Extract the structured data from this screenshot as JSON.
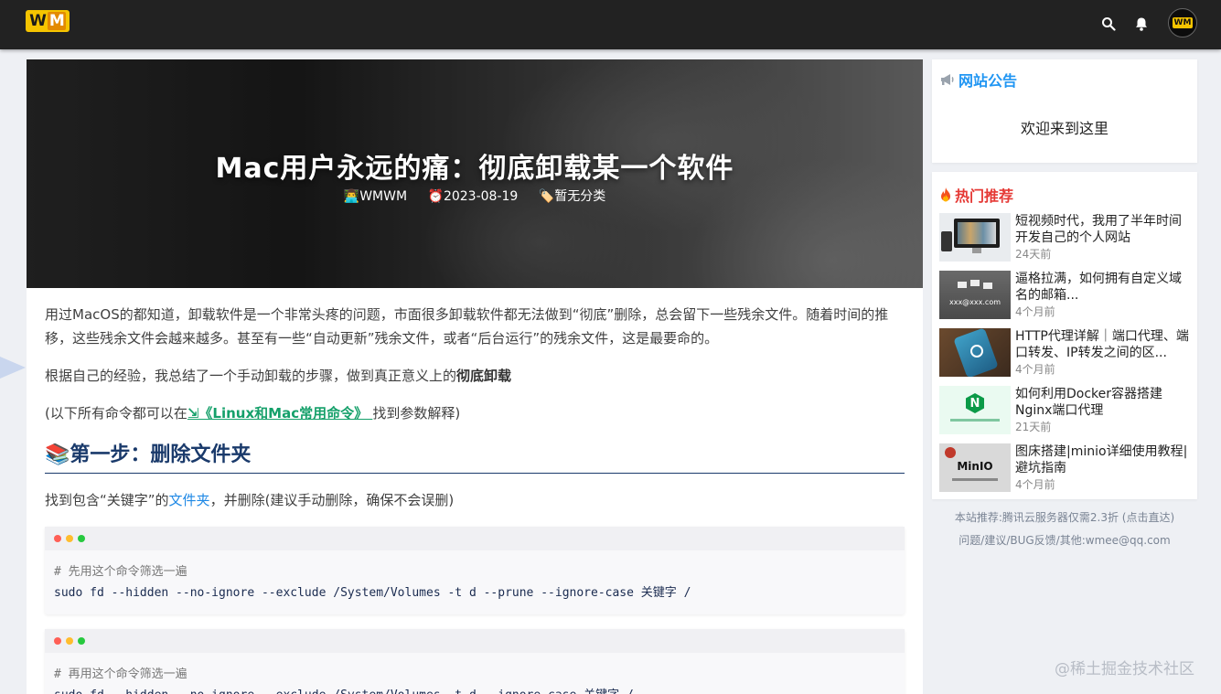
{
  "header": {
    "logo_w": "W",
    "logo_m": "M",
    "avatar_text": "WM",
    "icons": [
      "search-icon",
      "bell-icon"
    ]
  },
  "article": {
    "title": "Mac用户永远的痛：彻底卸载某一个软件",
    "author": "👨‍💻WMWM",
    "date": "⏰2023-08-19",
    "category": "🏷️暂无分类",
    "para1": "用过MacOS的都知道，卸载软件是一个非常头疼的问题，市面很多卸载软件都无法做到“彻底”删除，总会留下一些残余文件。随着时间的推移，这些残余文件会越来越多。甚至有一些“自动更新”残余文件，或者“后台运行”的残余文件，这是最要命的。",
    "para2_prefix": "根据自己的经验，我总结了一个手动卸载的步骤，做到真正意义上的",
    "para2_bold": "彻底卸载",
    "para3_prefix": "(以下所有命令都可以在",
    "para3_link": "⇲《Linux和Mac常用命令》 ",
    "para3_suffix": "找到参数解释)",
    "step1_heading": "📚第一步：删除文件夹",
    "step1_text_prefix": "找到包含“关键字”的",
    "step1_text_link": "文件夹",
    "step1_text_suffix": "，并删除(建议手动删除，确保不会误删)",
    "code1_comment": "# 先用这个命令筛选一遍",
    "code1_cmd": "sudo fd --hidden --no-ignore --exclude /System/Volumes  -t d --prune --ignore-case 关键字 /",
    "code2_comment": "# 再用这个命令筛选一遍",
    "code2_cmd": "sudo fd --hidden --no-ignore --exclude /System/Volumes  -t d --ignore-case 关键字 /"
  },
  "sidebar": {
    "notice_title": "网站公告",
    "notice_text": "欢迎来到这里",
    "hot_title": "热门推荐",
    "hot_items": [
      {
        "title": "短视频时代，我用了半年时间开发自己的个人网站",
        "date": "24天前"
      },
      {
        "title": "逼格拉满，如何拥有自定义域名的邮箱...",
        "date": "4个月前"
      },
      {
        "title": "HTTP代理详解｜端口代理、端口转发、IP转发之间的区...",
        "date": "4个月前"
      },
      {
        "title": "如何利用Docker容器搭建Nginx端口代理",
        "date": "21天前"
      },
      {
        "title": "图床搭建|minio详细使用教程|避坑指南",
        "date": "4个月前"
      }
    ],
    "thumb_texts": {
      "email": "xxx@xxx.com",
      "nginx": "N",
      "minio": "MinIO"
    },
    "footer1": "本站推荐:腾讯云服务器仅需2.3折 (点击直达)",
    "footer2": "问题/建议/BUG反馈/其他:wmee@qq.com"
  },
  "watermark": "@稀土掘金技术社区",
  "colors": {
    "topbar": "#222222",
    "notice_title": "#2196f3",
    "hot_title": "#e53935",
    "link_green": "#15a06a",
    "heading": "#1a3a6b"
  }
}
